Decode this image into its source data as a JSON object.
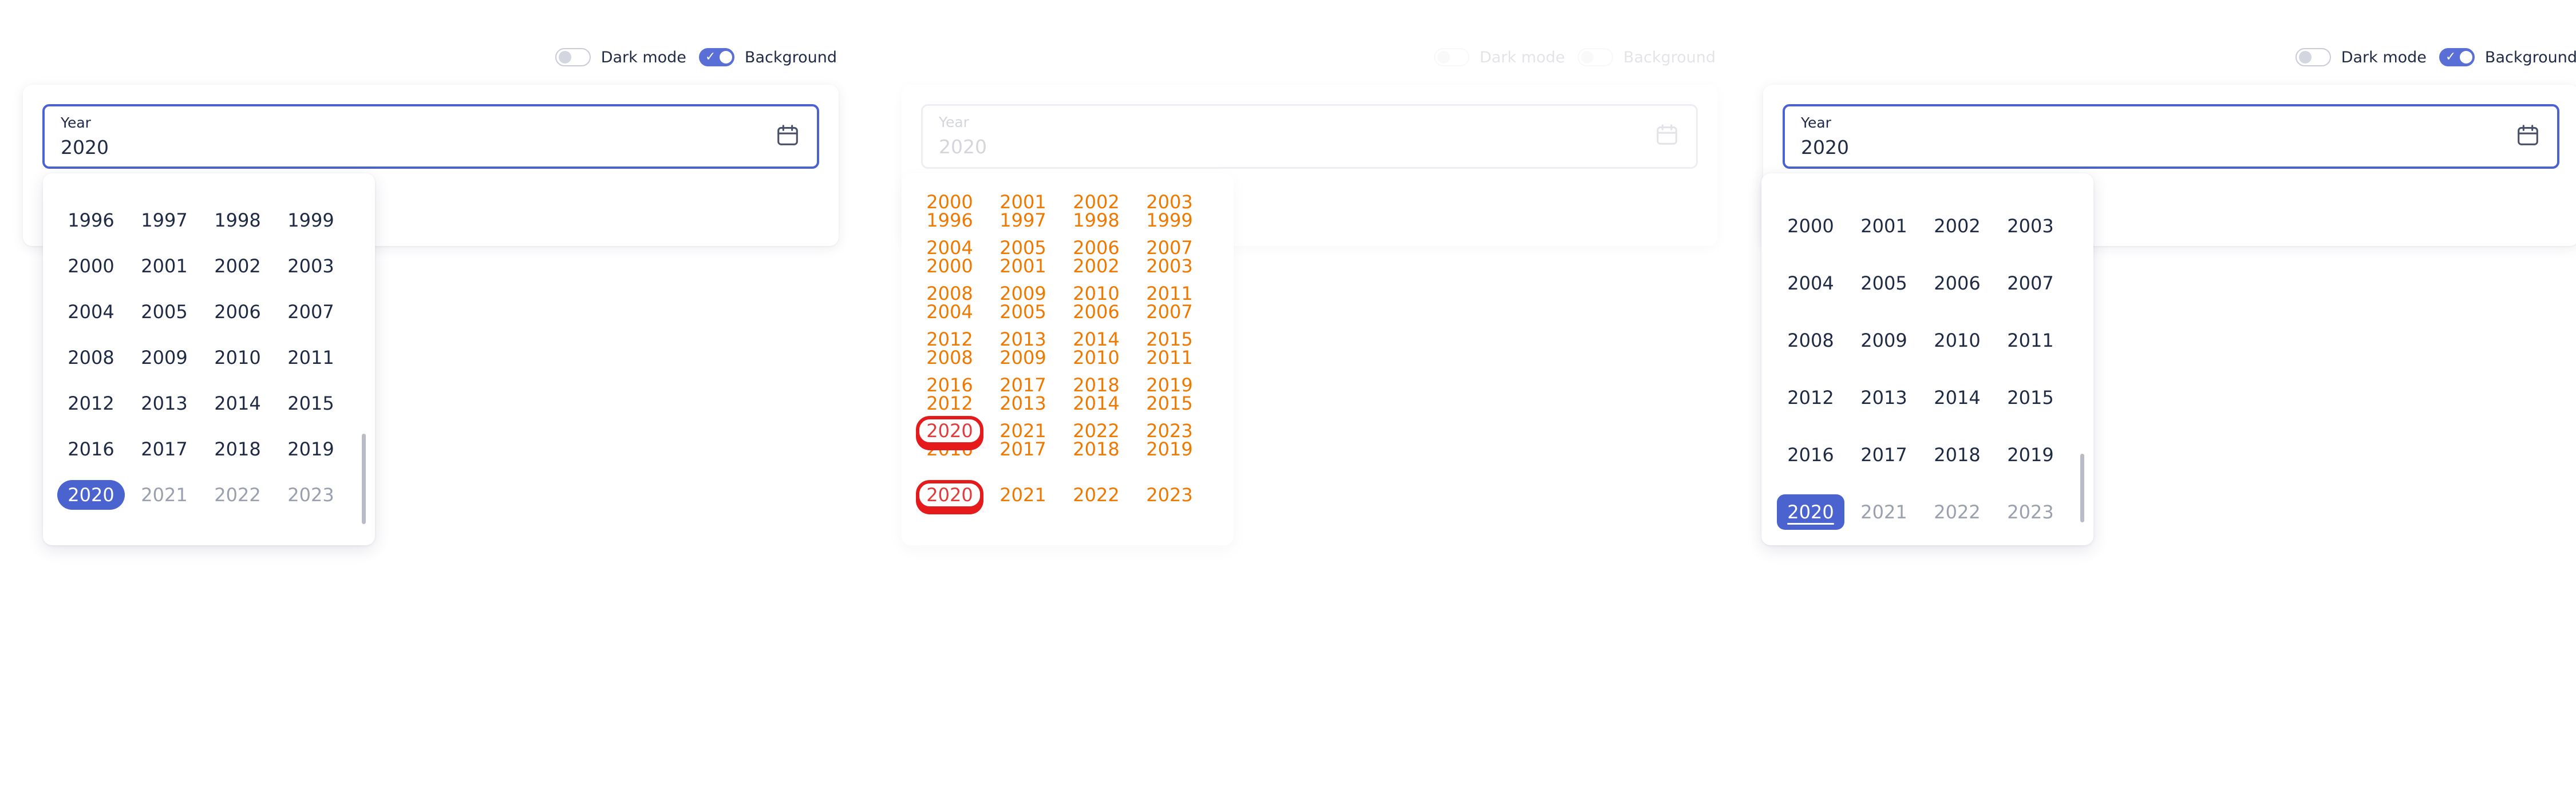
{
  "controls": {
    "dark_mode_label": "Dark mode",
    "background_label": "Background",
    "dark_mode_on": false,
    "background_on": true
  },
  "field": {
    "label": "Year",
    "value": "2020",
    "icon": "calendar-icon"
  },
  "picker_scrolled": {
    "years": [
      "1996",
      "1997",
      "1998",
      "1999",
      "2000",
      "2001",
      "2002",
      "2003",
      "2004",
      "2005",
      "2006",
      "2007",
      "2008",
      "2009",
      "2010",
      "2011",
      "2012",
      "2013",
      "2014",
      "2015",
      "2016",
      "2017",
      "2018",
      "2019",
      "2020",
      "2021",
      "2022",
      "2023"
    ],
    "selected": "2020",
    "muted": [
      "2021",
      "2022",
      "2023"
    ]
  },
  "picker_top": {
    "years": [
      "2000",
      "2001",
      "2002",
      "2003",
      "2004",
      "2005",
      "2006",
      "2007",
      "2008",
      "2009",
      "2010",
      "2011",
      "2012",
      "2013",
      "2014",
      "2015",
      "2016",
      "2017",
      "2018",
      "2019",
      "2020",
      "2021",
      "2022",
      "2023"
    ],
    "selected": "2020",
    "muted": [
      "2021",
      "2022",
      "2023"
    ]
  },
  "colors": {
    "accent": "#4a63cf",
    "text": "#1f2a44",
    "muted": "#9aa0ad",
    "glitch_orange": "#f07800",
    "glitch_red": "#e51a1a"
  }
}
